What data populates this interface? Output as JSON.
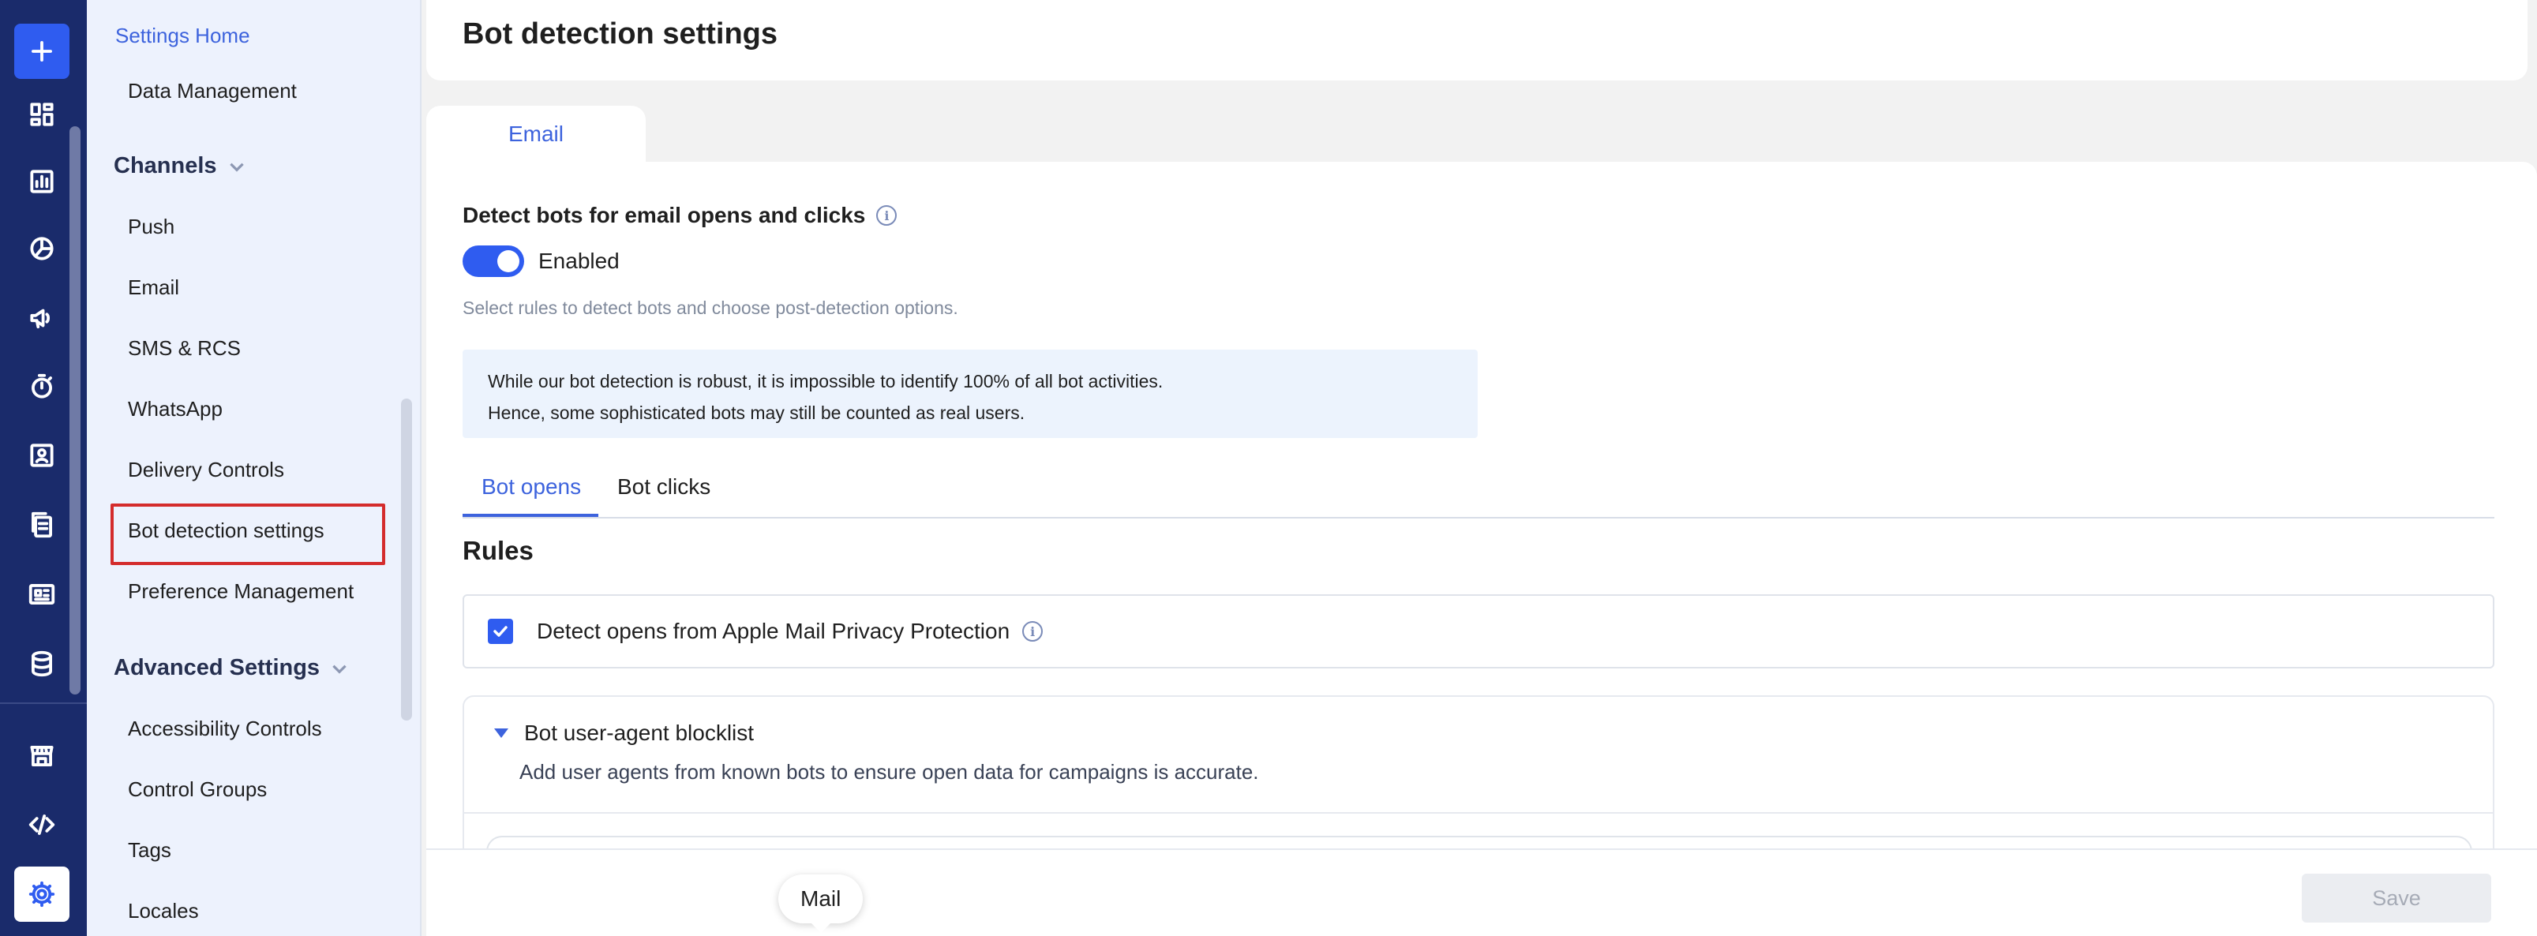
{
  "rail": {
    "icons": [
      "plus-icon",
      "dashboard-icon",
      "analytics-icon",
      "segments-icon",
      "campaigns-icon",
      "flows-icon",
      "user-icon",
      "content-icon",
      "templates-icon",
      "database-icon",
      "store-icon",
      "code-icon",
      "gear-icon"
    ]
  },
  "sidebar": {
    "settings_home": "Settings Home",
    "data_management": "Data Management",
    "channels_label": "Channels",
    "channels": [
      "Push",
      "Email",
      "SMS & RCS",
      "WhatsApp",
      "Delivery Controls",
      "Bot detection settings",
      "Preference Management"
    ],
    "advanced_label": "Advanced Settings",
    "advanced": [
      "Accessibility Controls",
      "Control Groups",
      "Tags",
      "Locales"
    ]
  },
  "header": {
    "title": "Bot detection settings"
  },
  "tabs": {
    "email": "Email"
  },
  "detect": {
    "title": "Detect bots for email opens and clicks",
    "toggle_label": "Enabled",
    "toggle_on": true,
    "helper": "Select rules to detect bots and choose post-detection options."
  },
  "notice": {
    "line1": "While our bot detection is robust, it is impossible to identify 100% of all bot activities.",
    "line2": "Hence, some sophisticated bots may still be counted as real users."
  },
  "subtabs": {
    "opens": "Bot opens",
    "clicks": "Bot clicks"
  },
  "rules": {
    "title": "Rules",
    "apple_mail_label": "Detect opens from Apple Mail Privacy Protection",
    "apple_mail_checked": true,
    "blocklist_title": "Bot user-agent blocklist",
    "blocklist_desc": "Add user agents from known bots to ensure open data for campaigns is accurate."
  },
  "footer": {
    "save_label": "Save"
  },
  "tooltip": {
    "text": "Mail"
  },
  "colors": {
    "accent": "#2f5cf0",
    "rail_bg": "#1a2b6b",
    "highlight": "#d42c2c"
  }
}
